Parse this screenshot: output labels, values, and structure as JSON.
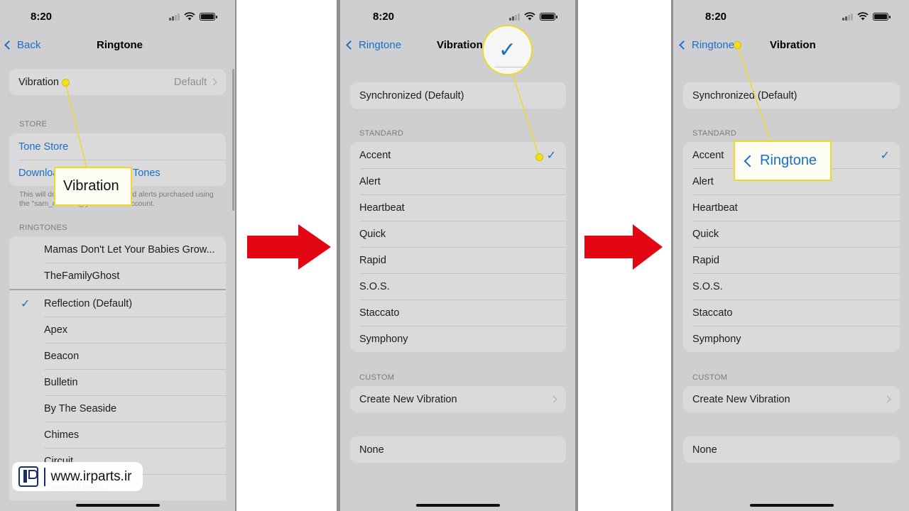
{
  "colors": {
    "accent": "#1a6fc9",
    "highlight": "#f5de1e",
    "arrow": "#e30613"
  },
  "screen1": {
    "time": "8:20",
    "back": "Back",
    "title": "Ringtone",
    "vibration_row": {
      "label": "Vibration",
      "value": "Default"
    },
    "store_header": "STORE",
    "store_links": [
      "Tone Store",
      "Download All Purchased Tones"
    ],
    "footnote": "This will download all ringtones and alerts purchased using the \"sam_costello@yahoo.com\" account.",
    "ringtones_header": "RINGTONES",
    "ringtones": [
      "Mamas Don't Let Your Babies Grow...",
      "TheFamilyGhost"
    ],
    "tones": [
      "Reflection (Default)",
      "Apex",
      "Beacon",
      "Bulletin",
      "By The Seaside",
      "Chimes",
      "Circuit",
      "Constellation"
    ],
    "selected_tone": "Reflection (Default)"
  },
  "screen2": {
    "time": "8:20",
    "back": "Ringtone",
    "title": "Vibration",
    "synchronized": "Synchronized (Default)",
    "standard_header": "STANDARD",
    "standard": [
      "Accent",
      "Alert",
      "Heartbeat",
      "Quick",
      "Rapid",
      "S.O.S.",
      "Staccato",
      "Symphony"
    ],
    "selected": "Accent",
    "custom_header": "CUSTOM",
    "create_new": "Create New Vibration",
    "none": "None"
  },
  "screen3": {
    "time": "8:20",
    "back": "Ringtone",
    "title": "Vibration",
    "synchronized": "Synchronized (Default)",
    "standard_header": "STANDARD",
    "standard": [
      "Accent",
      "Alert",
      "Heartbeat",
      "Quick",
      "Rapid",
      "S.O.S.",
      "Staccato",
      "Symphony"
    ],
    "selected": "Accent",
    "custom_header": "CUSTOM",
    "create_new": "Create New Vibration",
    "none": "None"
  },
  "callouts": {
    "vibration": "Vibration",
    "ringtone": "Ringtone",
    "check_icon": "checkmark-icon"
  },
  "watermark": {
    "text": "www.irparts.ir"
  }
}
